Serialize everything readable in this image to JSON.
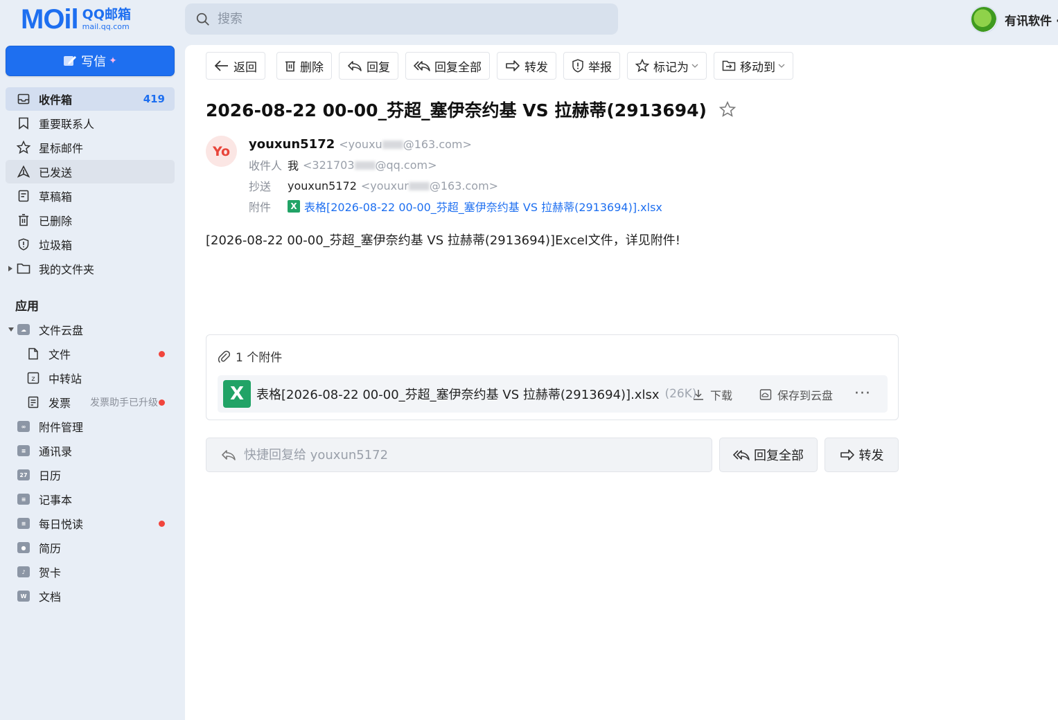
{
  "brand": {
    "logo_mail": "MOil",
    "logo_qq": "QQ邮箱",
    "logo_domain": "mail.qq.com"
  },
  "search": {
    "placeholder": "搜索"
  },
  "user": {
    "name": "有讯软件 ·"
  },
  "sidebar": {
    "compose_label": "写信",
    "folders": [
      {
        "label": "收件箱",
        "count": "419",
        "icon": "inbox-icon"
      },
      {
        "label": "重要联系人",
        "icon": "bookmark-icon"
      },
      {
        "label": "星标邮件",
        "icon": "star-icon"
      },
      {
        "label": "已发送",
        "icon": "send-icon"
      },
      {
        "label": "草稿箱",
        "icon": "draft-icon"
      },
      {
        "label": "已删除",
        "icon": "trash-icon"
      },
      {
        "label": "垃圾箱",
        "icon": "shield-icon"
      },
      {
        "label": "我的文件夹",
        "icon": "folder-icon"
      }
    ],
    "apps_title": "应用",
    "cloud": {
      "label": "文件云盘"
    },
    "cloud_items": [
      {
        "label": "文件"
      },
      {
        "label": "中转站"
      },
      {
        "label": "发票",
        "tip": "发票助手已升级"
      }
    ],
    "apps": [
      {
        "label": "附件管理",
        "glyph": "∞"
      },
      {
        "label": "通讯录",
        "glyph": "≡"
      },
      {
        "label": "日历",
        "glyph": "27"
      },
      {
        "label": "记事本",
        "glyph": "≡"
      },
      {
        "label": "每日悦读",
        "glyph": "≡"
      },
      {
        "label": "简历",
        "glyph": "●"
      },
      {
        "label": "贺卡",
        "glyph": "♪"
      },
      {
        "label": "文档",
        "glyph": "W"
      }
    ]
  },
  "toolbar": {
    "back": "返回",
    "delete": "删除",
    "reply": "回复",
    "reply_all": "回复全部",
    "forward": "转发",
    "report": "举报",
    "mark_as": "标记为",
    "move_to": "移动到"
  },
  "email": {
    "subject": "2026-08-22 00-00_芬超_塞伊奈约基 VS 拉赫蒂(2913694)",
    "avatar_text": "Yo",
    "sender_name": "youxun5172",
    "sender_addr_pre": "<youxu",
    "sender_addr_post": "@163.com>",
    "to_label": "收件人",
    "to_name": "我",
    "to_addr_pre": "<321703",
    "to_addr_post": "@qq.com>",
    "cc_label": "抄送",
    "cc_name": "youxun5172",
    "cc_addr_pre": "<youxur",
    "cc_addr_post": "@163.com>",
    "attach_label": "附件",
    "attach_link": "表格[2026-08-22 00-00_芬超_塞伊奈约基 VS 拉赫蒂(2913694)].xlsx",
    "body": "[2026-08-22 00-00_芬超_塞伊奈约基 VS 拉赫蒂(2913694)]Excel文件，详见附件!"
  },
  "attachments": {
    "header": "1 个附件",
    "file_name": "表格[2026-08-22 00-00_芬超_塞伊奈约基 VS 拉赫蒂(2913694)].xlsx",
    "file_size": "(26K)",
    "download": "下载",
    "save_cloud": "保存到云盘",
    "more": "···"
  },
  "quick_reply": {
    "placeholder": "快捷回复给 youxun5172",
    "reply_all": "回复全部",
    "forward": "转发"
  }
}
